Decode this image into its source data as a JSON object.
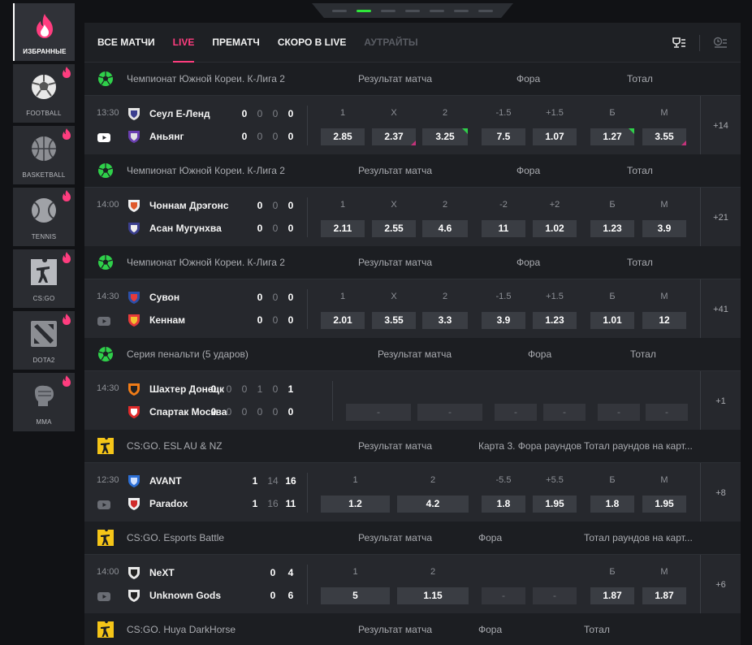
{
  "sidebar": {
    "items": [
      {
        "label": "ИЗБРАННЫЕ",
        "icon": "fire-icon",
        "active": true
      },
      {
        "label": "FOOTBALL",
        "icon": "football-icon"
      },
      {
        "label": "BASKETBALL",
        "icon": "basketball-icon"
      },
      {
        "label": "TENNIS",
        "icon": "tennis-icon"
      },
      {
        "label": "CS:GO",
        "icon": "csgo-icon"
      },
      {
        "label": "DOTA2",
        "icon": "dota2-icon"
      },
      {
        "label": "MMA",
        "icon": "mma-icon"
      }
    ]
  },
  "pager": {
    "active_index": 1,
    "count": 7
  },
  "tabs": [
    {
      "label": "ВСЕ МАТЧИ"
    },
    {
      "label": "LIVE"
    },
    {
      "label": "ПРЕМАТЧ"
    },
    {
      "label": "СКОРО В LIVE"
    },
    {
      "label": "АУТРАЙТЫ"
    }
  ],
  "colors": {
    "accent": "#ff3d7f",
    "active_green": "#2fe63a",
    "up_marker": "#2fd04a",
    "down_marker": "#c4327a"
  },
  "leagues": [
    {
      "name": "Чемпионат Южной Кореи. К-Лига 2",
      "icon": "soccer-ball-icon",
      "markets": [
        "Результат матча",
        "Фора",
        "Тотал"
      ],
      "event": {
        "time": "13:30",
        "stream": true,
        "team1": "Сеул Е-Ленд",
        "team2": "Аньянг",
        "scores1": [
          "0",
          "0",
          "0",
          "0"
        ],
        "scores2": [
          "0",
          "0",
          "0",
          "0"
        ],
        "labels": [
          "1",
          "X",
          "2",
          "-1.5",
          "+1.5",
          "Б",
          "М"
        ],
        "odds": [
          "2.85",
          "2.37",
          "3.25",
          "7.5",
          "1.07",
          "1.27",
          "3.55"
        ],
        "more": "+14"
      }
    },
    {
      "name": "Чемпионат Южной Кореи. К-Лига 2",
      "icon": "soccer-ball-icon",
      "markets": [
        "Результат матча",
        "Фора",
        "Тотал"
      ],
      "event": {
        "time": "14:00",
        "stream": false,
        "team1": "Чоннам Дрэгонс",
        "team2": "Асан Мугунхва",
        "scores1": [
          "0",
          "0",
          "0"
        ],
        "scores2": [
          "0",
          "0",
          "0"
        ],
        "labels": [
          "1",
          "X",
          "2",
          "-2",
          "+2",
          "Б",
          "М"
        ],
        "odds": [
          "2.11",
          "2.55",
          "4.6",
          "11",
          "1.02",
          "1.23",
          "3.9"
        ],
        "more": "+21"
      }
    },
    {
      "name": "Чемпионат Южной Кореи. К-Лига 2",
      "icon": "soccer-ball-icon",
      "markets": [
        "Результат матча",
        "Фора",
        "Тотал"
      ],
      "event": {
        "time": "14:30",
        "stream": true,
        "team1": "Сувон",
        "team2": "Кеннам",
        "scores1": [
          "0",
          "0",
          "0"
        ],
        "scores2": [
          "0",
          "0",
          "0"
        ],
        "labels": [
          "1",
          "X",
          "2",
          "-1.5",
          "+1.5",
          "Б",
          "М"
        ],
        "odds": [
          "2.01",
          "3.55",
          "3.3",
          "3.9",
          "1.23",
          "1.01",
          "12"
        ],
        "more": "+41"
      }
    },
    {
      "name": "Серия пенальти (5 ударов)",
      "icon": "soccer-ball-icon",
      "markets": [
        "Результат матча",
        "Фора",
        "Тотал"
      ],
      "event": {
        "time": "14:30",
        "stream": false,
        "team1": "Шахтер Донецк",
        "team2": "Спартак Москва",
        "scores1": [
          "0",
          "0",
          "0",
          "1",
          "0",
          "1"
        ],
        "scores2": [
          "0",
          "0",
          "0",
          "0",
          "0",
          "0"
        ],
        "labels": [],
        "odds": [
          "-",
          "-",
          "-",
          "-",
          "-",
          "-"
        ],
        "more": "+1"
      }
    },
    {
      "name": "CS:GO. ESL AU & NZ",
      "icon": "csgo-icon",
      "markets": [
        "Результат матча",
        "Карта 3. Фора раундов",
        "Тотал раундов на карт..."
      ],
      "event": {
        "time": "12:30",
        "stream": true,
        "team1": "AVANT",
        "team2": "Paradox",
        "scores1": [
          "1",
          "14",
          "16"
        ],
        "scores2": [
          "1",
          "16",
          "11"
        ],
        "labels": [
          "1",
          "2",
          "-5.5",
          "+5.5",
          "Б",
          "М"
        ],
        "odds": [
          "1.2",
          "4.2",
          "1.8",
          "1.95",
          "1.8",
          "1.95"
        ],
        "more": "+8"
      }
    },
    {
      "name": "CS:GO. Esports Battle",
      "icon": "csgo-icon",
      "markets": [
        "Результат матча",
        "Фора",
        "Тотал раундов на карт..."
      ],
      "event": {
        "time": "14:00",
        "stream": true,
        "team1": "NeXT",
        "team2": "Unknown Gods",
        "scores1": [
          "0",
          "4"
        ],
        "scores2": [
          "0",
          "6"
        ],
        "labels": [
          "1",
          "2",
          "Б",
          "М"
        ],
        "odds": [
          "5",
          "1.15",
          "-",
          "-",
          "1.87",
          "1.87"
        ],
        "more": "+6"
      }
    },
    {
      "name": "CS:GO. Huya DarkHorse",
      "icon": "csgo-icon",
      "markets": [
        "Результат матча",
        "Фора",
        "Тотал"
      ]
    }
  ]
}
